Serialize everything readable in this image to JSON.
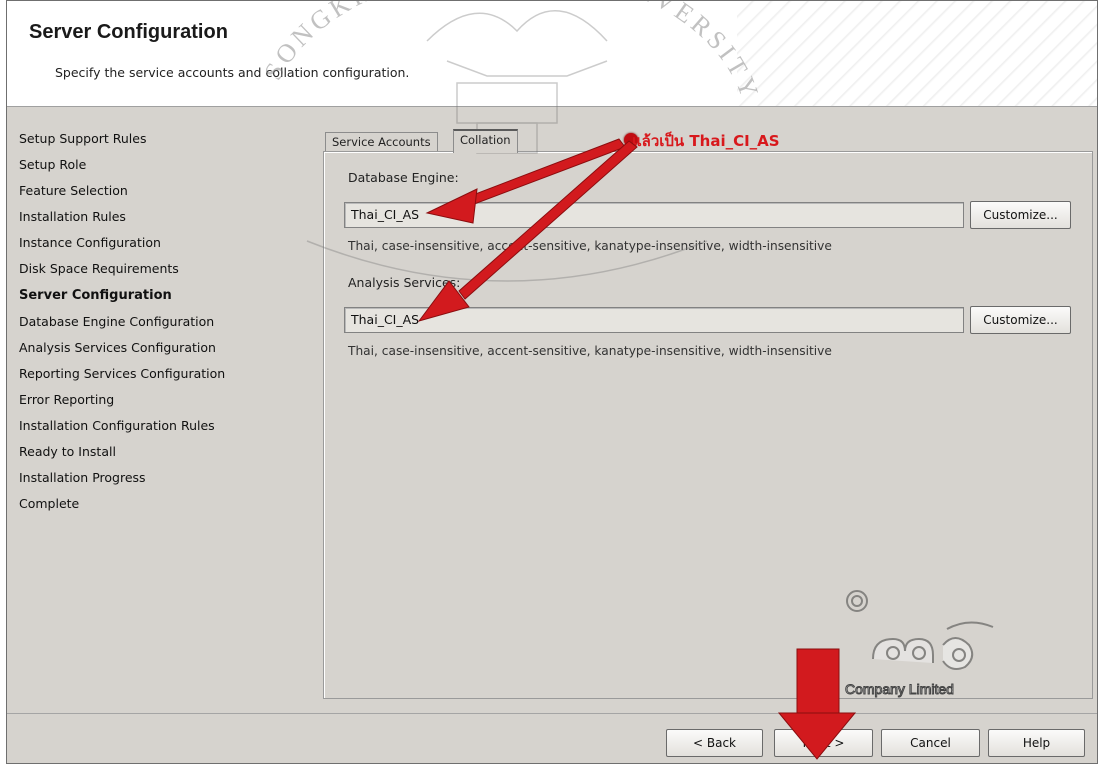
{
  "header": {
    "title": "Server Configuration",
    "subtitle": "Specify the service accounts and collation configuration."
  },
  "steps": [
    {
      "label": "Setup Support Rules",
      "active": false
    },
    {
      "label": "Setup Role",
      "active": false
    },
    {
      "label": "Feature Selection",
      "active": false
    },
    {
      "label": "Installation Rules",
      "active": false
    },
    {
      "label": "Instance Configuration",
      "active": false
    },
    {
      "label": "Disk Space Requirements",
      "active": false
    },
    {
      "label": "Server Configuration",
      "active": true
    },
    {
      "label": "Database Engine Configuration",
      "active": false
    },
    {
      "label": "Analysis Services Configuration",
      "active": false
    },
    {
      "label": "Reporting Services Configuration",
      "active": false
    },
    {
      "label": "Error Reporting",
      "active": false
    },
    {
      "label": "Installation Configuration Rules",
      "active": false
    },
    {
      "label": "Ready to Install",
      "active": false
    },
    {
      "label": "Installation Progress",
      "active": false
    },
    {
      "label": "Complete",
      "active": false
    }
  ],
  "tabs": [
    {
      "label": "Service Accounts",
      "selected": false
    },
    {
      "label": "Collation",
      "selected": true
    }
  ],
  "collation": {
    "database_engine": {
      "label": "Database Engine:",
      "value": "Thai_CI_AS",
      "customize_label": "Customize...",
      "description": "Thai, case-insensitive, accent-sensitive, kanatype-insensitive, width-insensitive"
    },
    "analysis_services": {
      "label": "Analysis Services:",
      "value": "Thai_CI_AS",
      "customize_label": "Customize...",
      "description": "Thai, case-insensitive, accent-sensitive, kanatype-insensitive, width-insensitive"
    }
  },
  "annotation": {
    "text": "แล้วเป็น Thai_CI_AS",
    "color": "#d8181c"
  },
  "footer": {
    "back_label": "< Back",
    "next_label": "Next >",
    "cancel_label": "Cancel",
    "help_label": "Help"
  },
  "watermark": {
    "top_text": "SONGKHLA RAJABHAT UNIVERSITY",
    "company_text": "Company Limited"
  },
  "colors": {
    "window_bg": "#d6d3ce",
    "annotation_red": "#d8181c"
  }
}
